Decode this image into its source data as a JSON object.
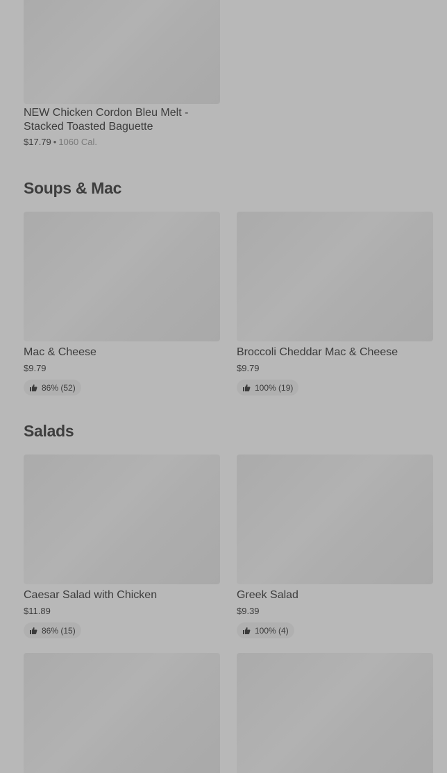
{
  "sections": {
    "soups_mac": "Soups & Mac",
    "salads": "Salads"
  },
  "items": {
    "cordon_bleu": {
      "name": "NEW Chicken Cordon Bleu Melt - Stacked Toasted Baguette",
      "price": "$17.79",
      "separator": "•",
      "calories": "1060 Cal."
    },
    "mac_cheese": {
      "name": "Mac & Cheese",
      "price": "$9.79",
      "rating": "86% (52)"
    },
    "broccoli_mac": {
      "name": "Broccoli Cheddar Mac & Cheese",
      "price": "$9.79",
      "rating": "100% (19)"
    },
    "caesar": {
      "name": "Caesar Salad with Chicken",
      "price": "$11.89",
      "rating": "86% (15)"
    },
    "greek": {
      "name": "Greek Salad",
      "price": "$9.39",
      "rating": "100% (4)"
    }
  },
  "icons": {
    "rating_icon": "thumbs-up-icon"
  }
}
